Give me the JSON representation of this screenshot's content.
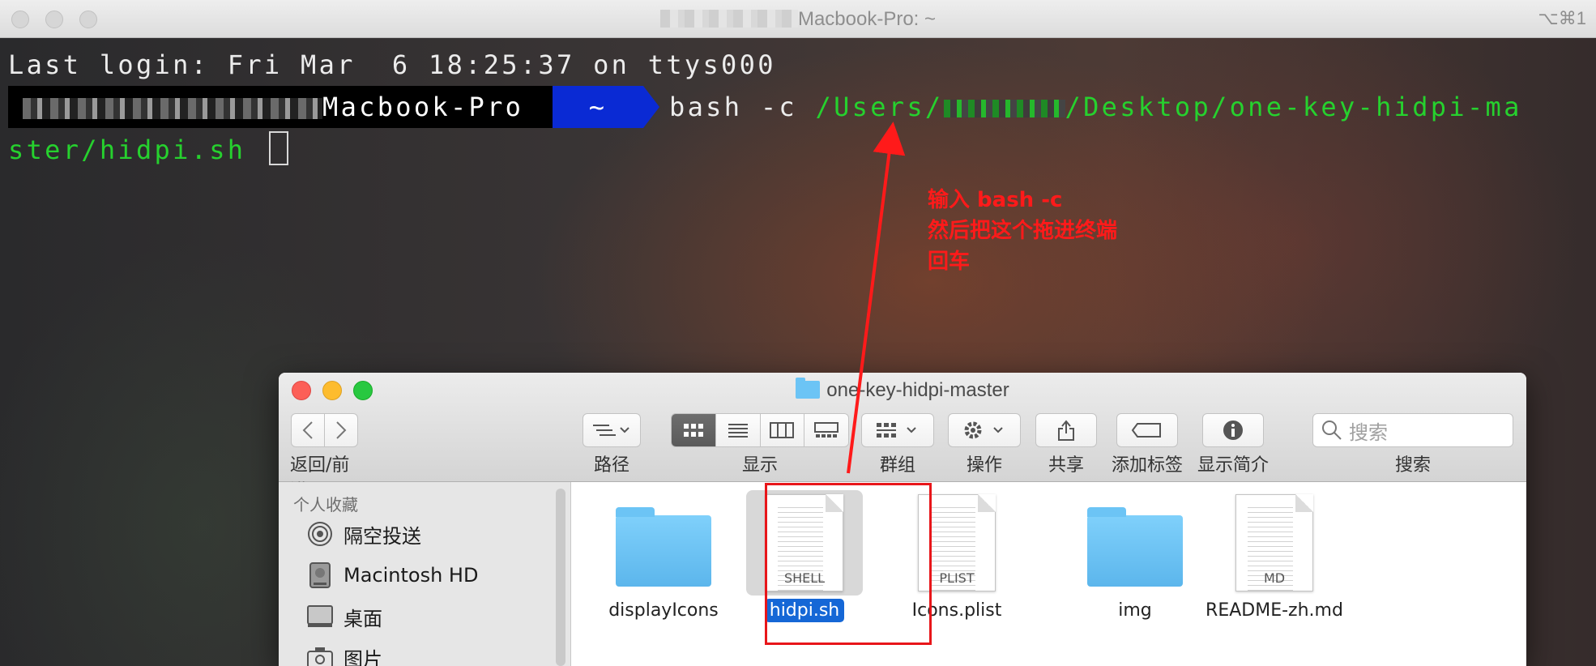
{
  "terminal": {
    "title_suffix": "Macbook-Pro: ~",
    "shortcut": "⌥⌘1",
    "last_login": "Last login: Fri Mar  6 18:25:37 on ttys000",
    "prompt_host": "Macbook-Pro",
    "prompt_dir": "~",
    "command_prefix": "bash -c ",
    "path_part1": "/Users/",
    "path_part2": "/Desktop/one-key-hidpi-ma",
    "path_line2": "ster/hidpi.sh "
  },
  "annotation": {
    "line1": "输入 bash -c",
    "line2": "然后把这个拖进终端",
    "line3": "回车",
    "color": "#ff1a1a"
  },
  "finder": {
    "title": "one-key-hidpi-master",
    "toolbar": {
      "back_forward_label": "返回/前进",
      "path_label": "路径",
      "view_label": "显示",
      "group_label": "群组",
      "action_label": "操作",
      "share_label": "共享",
      "tags_label": "添加标签",
      "info_label": "显示简介",
      "search_label": "搜索",
      "search_placeholder": "搜索"
    },
    "sidebar": {
      "header": "个人收藏",
      "items": [
        {
          "label": "隔空投送",
          "icon": "airdrop-icon"
        },
        {
          "label": "Macintosh HD",
          "icon": "harddisk-icon"
        },
        {
          "label": "桌面",
          "icon": "desktop-icon"
        },
        {
          "label": "图片",
          "icon": "camera-icon"
        }
      ]
    },
    "files": [
      {
        "name": "displayIcons",
        "kind": "folder"
      },
      {
        "name": "hidpi.sh",
        "kind": "doc",
        "tag": "SHELL",
        "selected": true
      },
      {
        "name": "Icons.plist",
        "kind": "doc",
        "tag": "PLIST"
      },
      {
        "name": "img",
        "kind": "folder"
      },
      {
        "name": "README-zh.md",
        "kind": "doc",
        "tag": "MD"
      }
    ]
  }
}
